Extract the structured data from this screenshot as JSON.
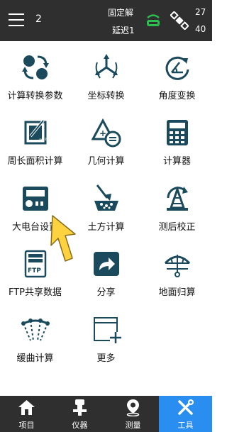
{
  "status_bar": {
    "count": "2",
    "solution_status": "固定解",
    "delay": "延迟1",
    "sats_used": "27",
    "sats_total": "40"
  },
  "tools": [
    {
      "label": "计算转换参数",
      "icon": "globe-arrows-icon"
    },
    {
      "label": "坐标转换",
      "icon": "coordinate-transform-icon"
    },
    {
      "label": "角度变换",
      "icon": "angle-transform-icon"
    },
    {
      "label": "周长面积计算",
      "icon": "perimeter-area-icon"
    },
    {
      "label": "几何计算",
      "icon": "geometry-calc-icon"
    },
    {
      "label": "计算器",
      "icon": "calculator-icon"
    },
    {
      "label": "大电台设置",
      "icon": "radio-icon"
    },
    {
      "label": "土方计算",
      "icon": "earthwork-icon"
    },
    {
      "label": "测后校正",
      "icon": "post-survey-correction-icon"
    },
    {
      "label": "FTP共享数据",
      "icon": "ftp-server-icon"
    },
    {
      "label": "分享",
      "icon": "share-icon"
    },
    {
      "label": "地面归算",
      "icon": "ground-reduction-icon"
    },
    {
      "label": "缓曲计算",
      "icon": "transition-curve-icon"
    },
    {
      "label": "更多",
      "icon": "more-icon"
    }
  ],
  "bottom_nav": [
    {
      "label": "项目",
      "icon": "home-icon"
    },
    {
      "label": "仪器",
      "icon": "instrument-icon"
    },
    {
      "label": "测量",
      "icon": "location-pin-icon"
    },
    {
      "label": "工具",
      "icon": "tools-icon",
      "active": true
    }
  ],
  "colors": {
    "bar_bg": "#2f2f2f",
    "accent": "#2a8df0",
    "icon_dark": "#1a4a5c",
    "rtk_green": "#2bbf4e",
    "pointer_yellow": "#ffd23f"
  }
}
